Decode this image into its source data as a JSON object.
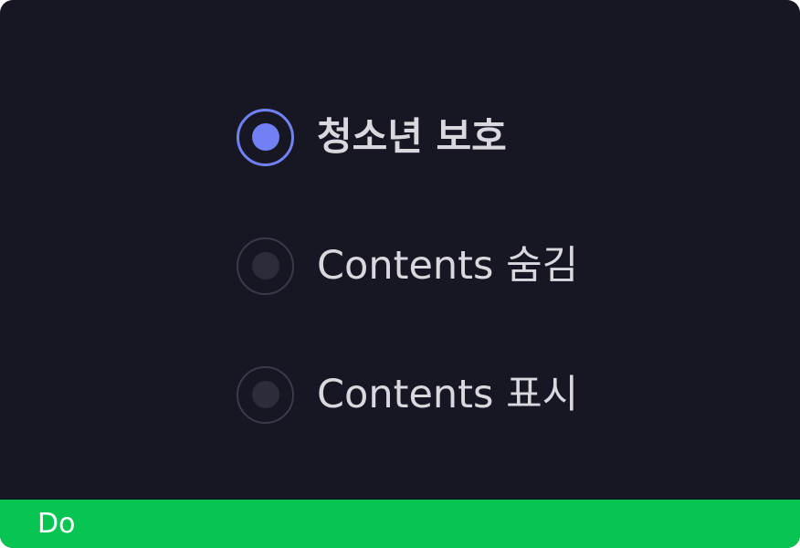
{
  "radio_group": {
    "selected_index": 0,
    "options": [
      {
        "label": "청소년 보호",
        "selected": true
      },
      {
        "label": "Contents 숨김",
        "selected": false
      },
      {
        "label": "Contents 표시",
        "selected": false
      }
    ]
  },
  "footer": {
    "label": "Do"
  },
  "colors": {
    "background": "#171724",
    "accent": "#7181f4",
    "text": "#d8d8de",
    "radio_inactive_border": "#3a3a48",
    "radio_inactive_dot": "#2c2c3a",
    "footer_background": "#08c553",
    "footer_text": "#ffffff"
  }
}
